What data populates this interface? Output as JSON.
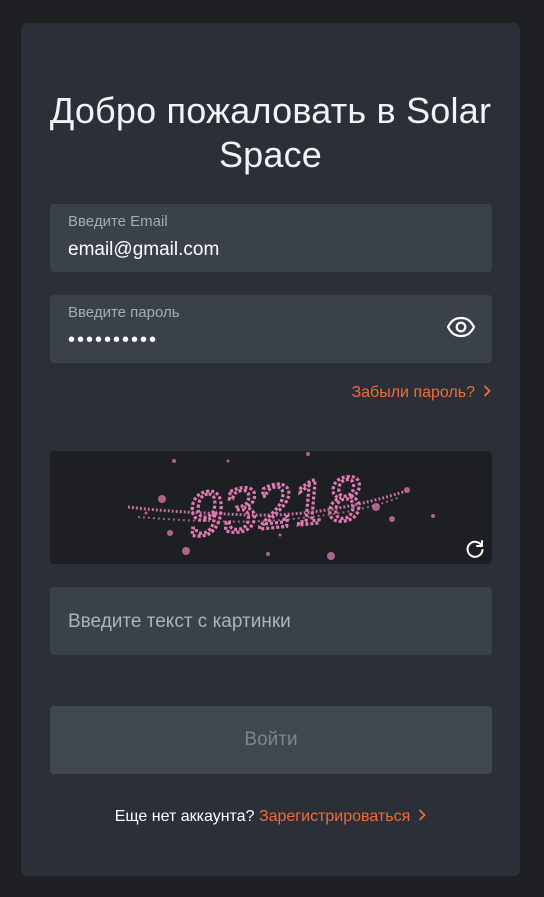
{
  "title": "Добро пожаловать в Solar Space",
  "email": {
    "label": "Введите Email",
    "value": "email@gmail.com"
  },
  "password": {
    "label": "Введите пароль",
    "value": "••••••••••"
  },
  "forgot": {
    "label": "Забыли пароль?"
  },
  "captcha": {
    "text": "93218",
    "input_placeholder": "Введите текст с картинки"
  },
  "login_button": "Войти",
  "footer": {
    "question": "Еще нет аккаунта?",
    "register_link": "Зарегистрироваться"
  },
  "colors": {
    "accent": "#f26b3a",
    "background": "#1e2024",
    "card": "#2b3038",
    "field": "#3b414b",
    "captcha_ink": "#e07ab3"
  },
  "icons": {
    "password_toggle": "eye-icon",
    "captcha_refresh": "refresh-icon",
    "link_arrow": "chevron-right-icon"
  }
}
